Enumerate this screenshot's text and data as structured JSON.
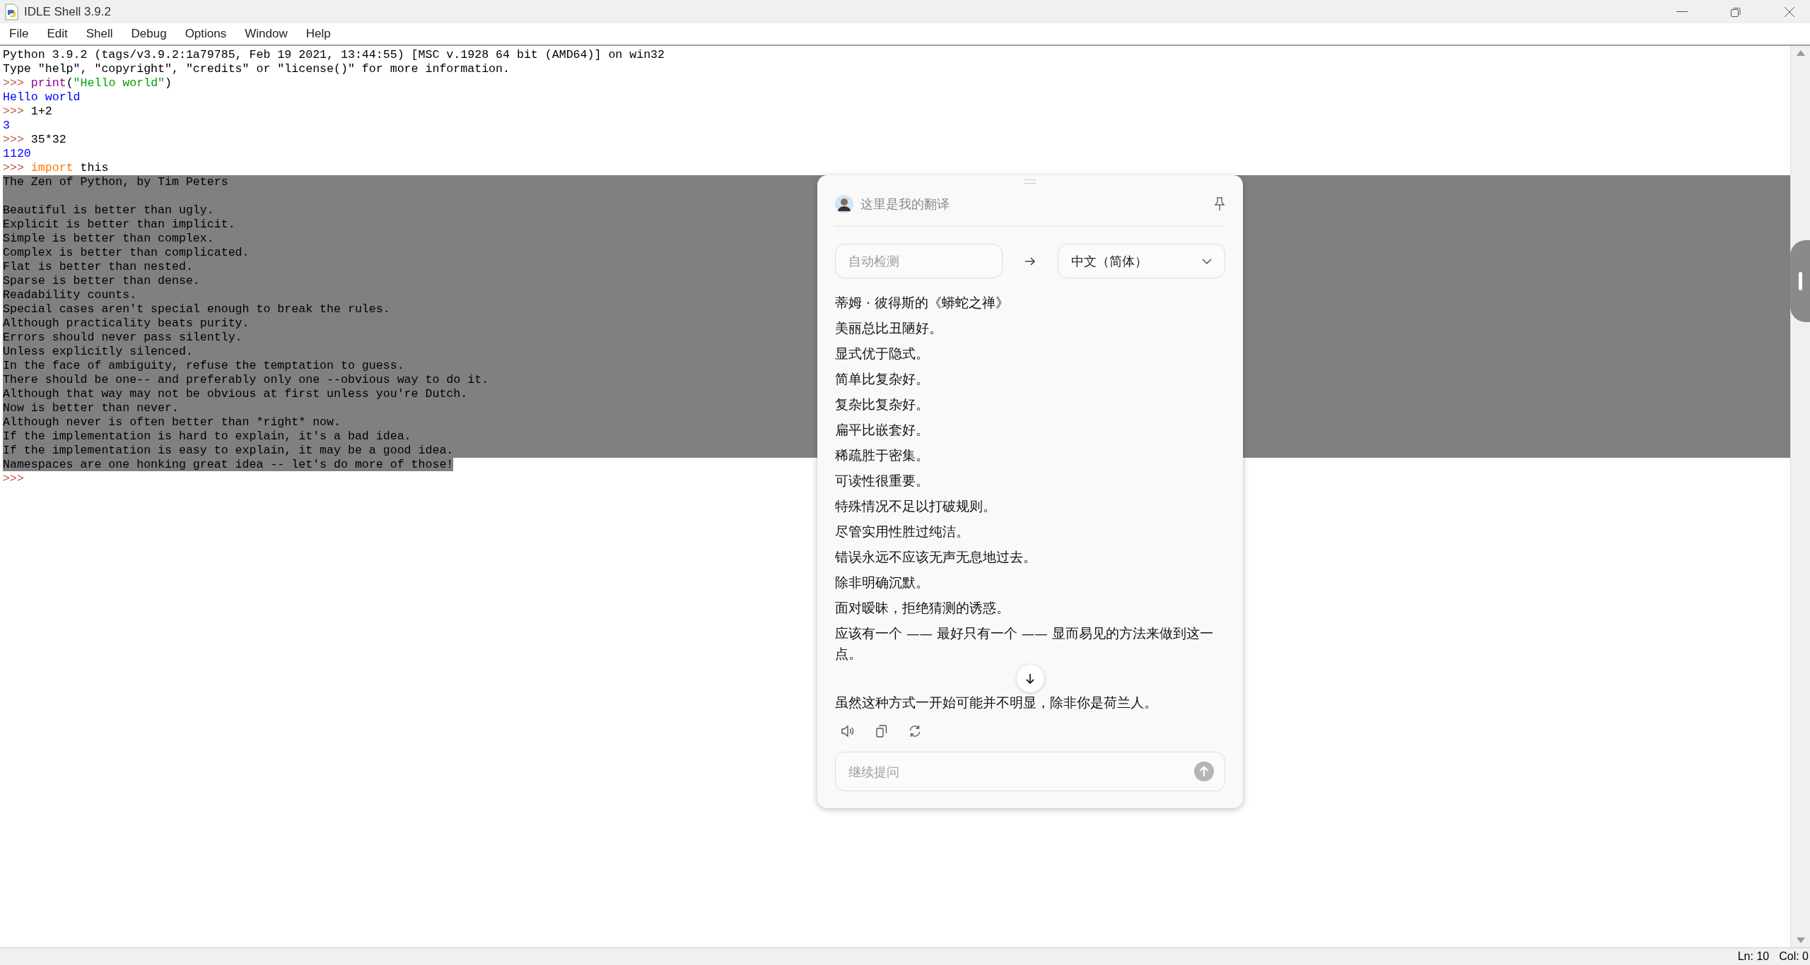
{
  "window": {
    "title": "IDLE Shell 3.9.2"
  },
  "menu": [
    "File",
    "Edit",
    "Shell",
    "Debug",
    "Options",
    "Window",
    "Help"
  ],
  "shell": {
    "lines": [
      {
        "segments": [
          {
            "kind": "plain",
            "text": "Python 3.9.2 (tags/v3.9.2:1a79785, Feb 19 2021, 13:44:55) [MSC v.1928 64 bit (AMD64)] on win32"
          }
        ],
        "selected": false
      },
      {
        "segments": [
          {
            "kind": "plain",
            "text": "Type \"help\", \"copyright\", \"credits\" or \"license()\" for more information."
          }
        ],
        "selected": false
      },
      {
        "segments": [
          {
            "kind": "prompt",
            "text": ">>> "
          },
          {
            "kind": "builtin",
            "text": "print"
          },
          {
            "kind": "plain",
            "text": "("
          },
          {
            "kind": "string",
            "text": "\"Hello world\""
          },
          {
            "kind": "plain",
            "text": ")"
          }
        ],
        "selected": false
      },
      {
        "segments": [
          {
            "kind": "stdout",
            "text": "Hello world"
          }
        ],
        "selected": false
      },
      {
        "segments": [
          {
            "kind": "prompt",
            "text": ">>> "
          },
          {
            "kind": "plain",
            "text": "1+2"
          }
        ],
        "selected": false
      },
      {
        "segments": [
          {
            "kind": "stdout",
            "text": "3"
          }
        ],
        "selected": false
      },
      {
        "segments": [
          {
            "kind": "prompt",
            "text": ">>> "
          },
          {
            "kind": "plain",
            "text": "35*32"
          }
        ],
        "selected": false
      },
      {
        "segments": [
          {
            "kind": "stdout",
            "text": "1120"
          }
        ],
        "selected": false
      },
      {
        "segments": [
          {
            "kind": "prompt",
            "text": ">>> "
          },
          {
            "kind": "keyword",
            "text": "import"
          },
          {
            "kind": "plain",
            "text": " this"
          }
        ],
        "selected": false
      },
      {
        "segments": [
          {
            "kind": "plain",
            "text": "The Zen of Python, by Tim Peters"
          }
        ],
        "selected": true
      },
      {
        "selected": true
      },
      {
        "segments": [
          {
            "kind": "plain",
            "text": "Beautiful is better than ugly."
          }
        ],
        "selected": true
      },
      {
        "segments": [
          {
            "kind": "plain",
            "text": "Explicit is better than implicit."
          }
        ],
        "selected": true
      },
      {
        "segments": [
          {
            "kind": "plain",
            "text": "Simple is better than complex."
          }
        ],
        "selected": true
      },
      {
        "segments": [
          {
            "kind": "plain",
            "text": "Complex is better than complicated."
          }
        ],
        "selected": true
      },
      {
        "segments": [
          {
            "kind": "plain",
            "text": "Flat is better than nested."
          }
        ],
        "selected": true
      },
      {
        "segments": [
          {
            "kind": "plain",
            "text": "Sparse is better than dense."
          }
        ],
        "selected": true
      },
      {
        "segments": [
          {
            "kind": "plain",
            "text": "Readability counts."
          }
        ],
        "selected": true
      },
      {
        "segments": [
          {
            "kind": "plain",
            "text": "Special cases aren't special enough to break the rules."
          }
        ],
        "selected": true
      },
      {
        "segments": [
          {
            "kind": "plain",
            "text": "Although practicality beats purity."
          }
        ],
        "selected": true
      },
      {
        "segments": [
          {
            "kind": "plain",
            "text": "Errors should never pass silently."
          }
        ],
        "selected": true
      },
      {
        "segments": [
          {
            "kind": "plain",
            "text": "Unless explicitly silenced."
          }
        ],
        "selected": true
      },
      {
        "segments": [
          {
            "kind": "plain",
            "text": "In the face of ambiguity, refuse the temptation to guess."
          }
        ],
        "selected": true
      },
      {
        "segments": [
          {
            "kind": "plain",
            "text": "There should be one-- and preferably only one --obvious way to do it."
          }
        ],
        "selected": true
      },
      {
        "segments": [
          {
            "kind": "plain",
            "text": "Although that way may not be obvious at first unless you're Dutch."
          }
        ],
        "selected": true
      },
      {
        "segments": [
          {
            "kind": "plain",
            "text": "Now is better than never."
          }
        ],
        "selected": true
      },
      {
        "segments": [
          {
            "kind": "plain",
            "text": "Although never is often better than *right* now."
          }
        ],
        "selected": true
      },
      {
        "segments": [
          {
            "kind": "plain",
            "text": "If the implementation is hard to explain, it's a bad idea."
          }
        ],
        "selected": true
      },
      {
        "segments": [
          {
            "kind": "plain",
            "text": "If the implementation is easy to explain, it may be a good idea."
          }
        ],
        "selected": true
      },
      {
        "segments": [
          {
            "kind": "plain",
            "text": "Namespaces are one honking great idea -- let's do more of those!"
          }
        ],
        "selected": true
      },
      {
        "segments": [
          {
            "kind": "prompt",
            "text": ">>>"
          }
        ],
        "selected": false
      }
    ]
  },
  "status_bar": {
    "line": "Ln: 10",
    "column": "Col: 0"
  },
  "translator": {
    "title": "这里是我的翻译",
    "source_language": {
      "placeholder": "自动检测"
    },
    "target_language": "中文（简体）",
    "paragraphs": [
      "蒂姆 · 彼得斯的《蟒蛇之禅》",
      "美丽总比丑陋好。",
      "显式优于隐式。",
      "简单比复杂好。",
      "复杂比复杂好。",
      "扁平比嵌套好。",
      "稀疏胜于密集。",
      "可读性很重要。",
      "特殊情况不足以打破规则。",
      "尽管实用性胜过纯洁。",
      "错误永远不应该无声无息地过去。",
      "除非明确沉默。",
      "面对暧昧，拒绝猜测的诱惑。",
      "应该有一个 —— 最好只有一个 —— 显而易见的方法来做到这一点。",
      "虽然这种方式一开始可能并不明显，除非你是荷兰人。"
    ],
    "input": {
      "placeholder": "继续提问"
    }
  }
}
